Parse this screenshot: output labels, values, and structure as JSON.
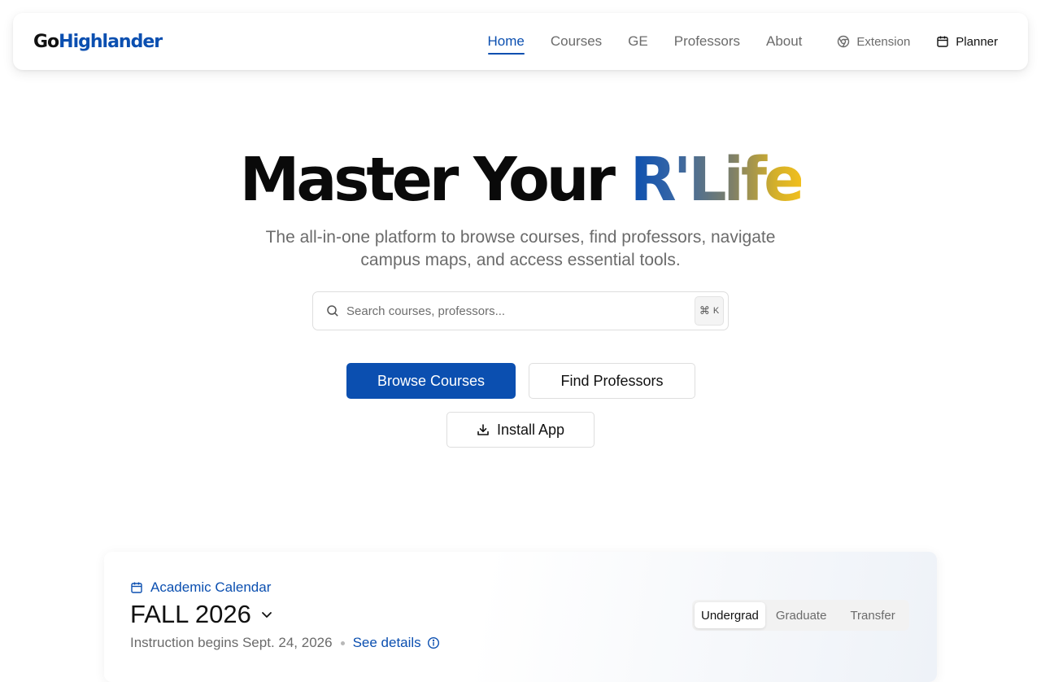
{
  "nav": {
    "logo_prefix": "Go",
    "logo_suffix": "Highlander",
    "links": [
      {
        "label": "Home",
        "active": true
      },
      {
        "label": "Courses"
      },
      {
        "label": "GE"
      },
      {
        "label": "Professors"
      },
      {
        "label": "About"
      }
    ],
    "extension_label": "Extension",
    "planner_label": "Planner"
  },
  "hero": {
    "title_main": "Master Your ",
    "title_accent": "R'Life",
    "subtitle": "The all-in-one platform to browse courses, find professors, navigate campus maps, and access essential tools.",
    "gradient_colors": [
      "#0b4fb0",
      "#7f8068",
      "#f1bf1e"
    ]
  },
  "search": {
    "placeholder": "Search courses, professors...",
    "shortcut_symbol": "⌘",
    "shortcut_key": "K"
  },
  "actions": {
    "browse_courses": "Browse Courses",
    "find_professors": "Find Professors",
    "install_app": "Install App"
  },
  "calendar": {
    "section_label": "Academic Calendar",
    "term": "FALL 2026",
    "instruction_text": "Instruction begins Sept. 24, 2026",
    "details_link": "See details",
    "tabs": [
      {
        "label": "Undergrad",
        "active": true
      },
      {
        "label": "Graduate"
      },
      {
        "label": "Transfer"
      }
    ]
  },
  "colors": {
    "brand_blue": "#0b4fb0",
    "text_primary": "#111111",
    "text_muted": "#6b6b6b"
  }
}
